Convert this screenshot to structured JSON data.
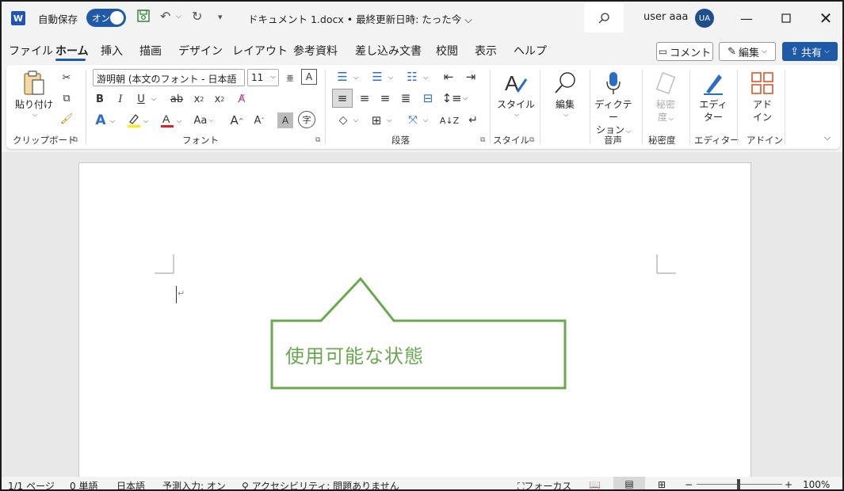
{
  "titlebar": {
    "autosave_label": "自動保存",
    "autosave_state": "オン",
    "doc_title": "ドキュメント 1.docx • 最終更新日時: たった今 ⌵",
    "user_name": "user aaa",
    "user_initials": "UA",
    "app_logo": "W"
  },
  "tabs": [
    "ファイル",
    "ホーム",
    "挿入",
    "描画",
    "デザイン",
    "レイアウト",
    "参考資料",
    "差し込み文書",
    "校閲",
    "表示",
    "ヘルプ"
  ],
  "actions": {
    "comment": "コメント",
    "edit": "編集",
    "share": "共有"
  },
  "ribbon": {
    "clipboard": {
      "paste": "貼り付け",
      "label": "クリップボード"
    },
    "font": {
      "font_name": "游明朝 (本文のフォント - 日本語",
      "font_size": "11",
      "label": "フォント"
    },
    "paragraph": {
      "label": "段落"
    },
    "styles": {
      "button": "スタイル",
      "label": "スタイル"
    },
    "editing": {
      "button": "編集"
    },
    "voice": {
      "button_line1": "ディクテー",
      "button_line2": "ション",
      "label": "音声"
    },
    "sensitivity": {
      "button_line1": "秘密",
      "button_line2": "度",
      "label": "秘密度"
    },
    "editor": {
      "button_line1": "エディ",
      "button_line2": "ター",
      "label": "エディター"
    },
    "addins": {
      "button_line1": "アド",
      "button_line2": "イン",
      "label": "アドイン"
    }
  },
  "callout": {
    "text": "使用可能な状態"
  },
  "colors": {
    "accent": "#1e5aa8",
    "callout": "#6aa84f"
  },
  "statusbar": {
    "page": "1/1 ページ",
    "words": "0 単語",
    "language": "日本語",
    "predictive": "予測入力: オン",
    "accessibility": "アクセシビリティ: 問題ありません",
    "focus": "フォーカス",
    "zoom": "100%"
  }
}
